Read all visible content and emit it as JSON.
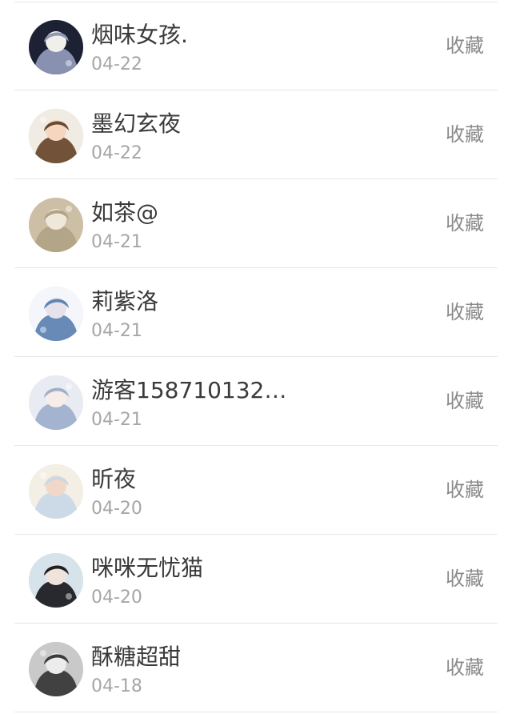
{
  "items": [
    {
      "name": "烟味女孩.",
      "date": "04-22",
      "action": "收藏",
      "avatar": "avatar-dark-figure-icon",
      "colors": [
        "#1c2233",
        "#8e98b6",
        "#f1efe9"
      ]
    },
    {
      "name": "墨幻玄夜",
      "date": "04-22",
      "action": "收藏",
      "avatar": "avatar-anime-girl-brown-icon",
      "colors": [
        "#f0ebe3",
        "#6a4a2f",
        "#f5d7c0"
      ]
    },
    {
      "name": "如茶@",
      "date": "04-21",
      "action": "收藏",
      "avatar": "avatar-beige-illustration-icon",
      "colors": [
        "#cdbfa5",
        "#b1a386",
        "#efe7d9"
      ]
    },
    {
      "name": "莉紫洛",
      "date": "04-21",
      "action": "收藏",
      "avatar": "avatar-blue-white-figure-icon",
      "colors": [
        "#f4f6fb",
        "#5f84b3",
        "#e7e1ea"
      ]
    },
    {
      "name": "游客158710132…",
      "date": "04-21",
      "action": "收藏",
      "avatar": "avatar-doll-girl-icon",
      "colors": [
        "#e8ecf2",
        "#9fb0cd",
        "#f8ece9"
      ]
    },
    {
      "name": "昕夜",
      "date": "04-20",
      "action": "收藏",
      "avatar": "avatar-pastel-anime-icon",
      "colors": [
        "#f3efe5",
        "#c9d8e7",
        "#f1d7c8"
      ]
    },
    {
      "name": "咪咪无忧猫",
      "date": "04-20",
      "action": "收藏",
      "avatar": "avatar-girl-profile-icon",
      "colors": [
        "#d7e3ea",
        "#1f1f24",
        "#efe3dc"
      ]
    },
    {
      "name": "酥糖超甜",
      "date": "04-18",
      "action": "收藏",
      "avatar": "avatar-grayscale-girl-icon",
      "colors": [
        "#c9c9c9",
        "#3a3a3a",
        "#ececec"
      ]
    }
  ]
}
